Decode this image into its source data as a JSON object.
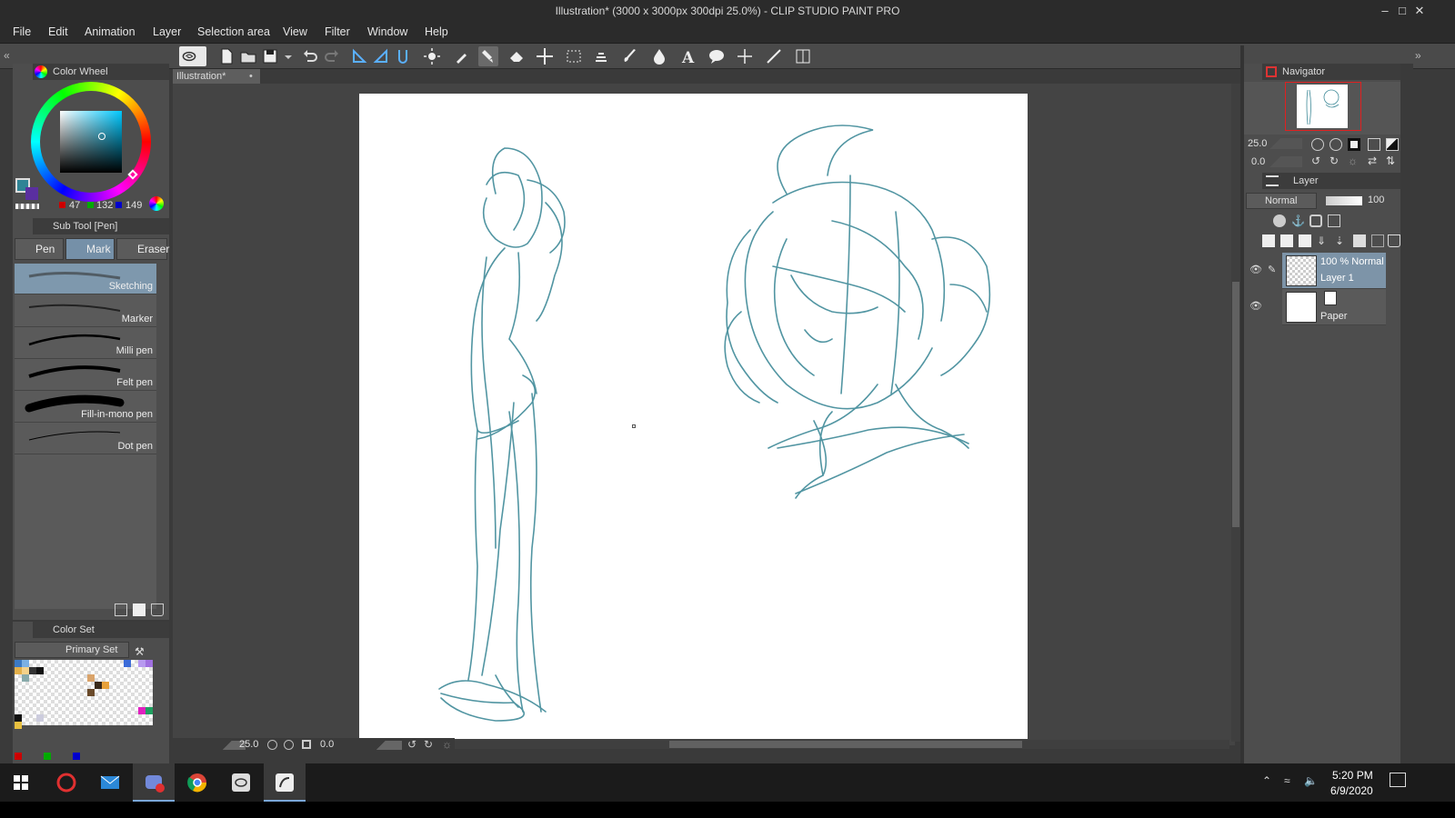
{
  "window": {
    "title": "Illustration* (3000 x 3000px 300dpi 25.0%) - CLIP STUDIO PAINT PRO"
  },
  "menu": [
    "File",
    "Edit",
    "Animation",
    "Layer",
    "Selection area",
    "View",
    "Filter",
    "Window",
    "Help"
  ],
  "color_wheel": {
    "tab_label": "Color Wheel",
    "r": "47",
    "g": "132",
    "b": "149",
    "current_color": "#2f8495"
  },
  "sub_tool": {
    "tab_label": "Sub Tool [Pen]",
    "groups": [
      "Pen",
      "Marker",
      "Eraser"
    ],
    "group_visible": [
      "Pen",
      "Mark",
      "Eraser"
    ],
    "brushes": [
      "Sketching",
      "Marker",
      "Milli pen",
      "Felt pen",
      "Fill-in-mono pen",
      "Dot pen"
    ],
    "selected_brush": "Sketching"
  },
  "color_set": {
    "tab_label": "Color Set",
    "set_name": "Primary Set"
  },
  "document": {
    "tab_label": "Illustration*"
  },
  "status": {
    "zoom": "25.0",
    "rotation": "0.0"
  },
  "navigator": {
    "tab_label": "Navigator",
    "zoom": "25.0",
    "rotation": "0.0"
  },
  "layer_panel": {
    "tab_label": "Layer",
    "blend_mode": "Normal",
    "opacity": "100",
    "layers": [
      {
        "info": "100 % Normal",
        "name": "Layer 1",
        "selected": true
      },
      {
        "info": "",
        "name": "Paper",
        "selected": false
      }
    ]
  },
  "taskbar": {
    "time": "5:20 PM",
    "date": "6/9/2020"
  },
  "colors": {
    "sketch": "#3f8a98",
    "accent": "#2f8495",
    "ui_bg": "#4d4d4d"
  }
}
